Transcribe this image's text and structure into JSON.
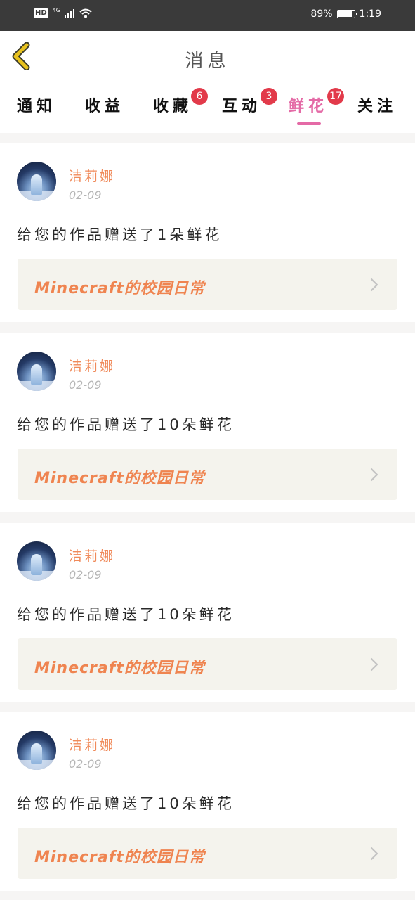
{
  "status_bar": {
    "hd": "HD",
    "network": "4G",
    "battery_text": "89%",
    "battery_level": 0.89,
    "time": "1:19"
  },
  "navbar": {
    "title": "消息"
  },
  "tabs": [
    {
      "label": "通知",
      "badge": ""
    },
    {
      "label": "收益",
      "badge": ""
    },
    {
      "label": "收藏",
      "badge": "6"
    },
    {
      "label": "互动",
      "badge": "3"
    },
    {
      "label": "鲜花",
      "badge": "17",
      "active": true
    },
    {
      "label": "关注",
      "badge": ""
    }
  ],
  "messages": [
    {
      "user": "洁莉娜",
      "date": "02-09",
      "text": "给您的作品赠送了1朵鲜花",
      "work": "Minecraft的校园日常"
    },
    {
      "user": "洁莉娜",
      "date": "02-09",
      "text": "给您的作品赠送了10朵鲜花",
      "work": "Minecraft的校园日常"
    },
    {
      "user": "洁莉娜",
      "date": "02-09",
      "text": "给您的作品赠送了10朵鲜花",
      "work": "Minecraft的校园日常"
    },
    {
      "user": "洁莉娜",
      "date": "02-09",
      "text": "给您的作品赠送了10朵鲜花",
      "work": "Minecraft的校园日常"
    }
  ],
  "colors": {
    "accent": "#e46aa6",
    "badge": "#e23a4a",
    "username": "#f08a5a",
    "work_title": "#ef8450",
    "back_arrow": "#e8c21e"
  }
}
